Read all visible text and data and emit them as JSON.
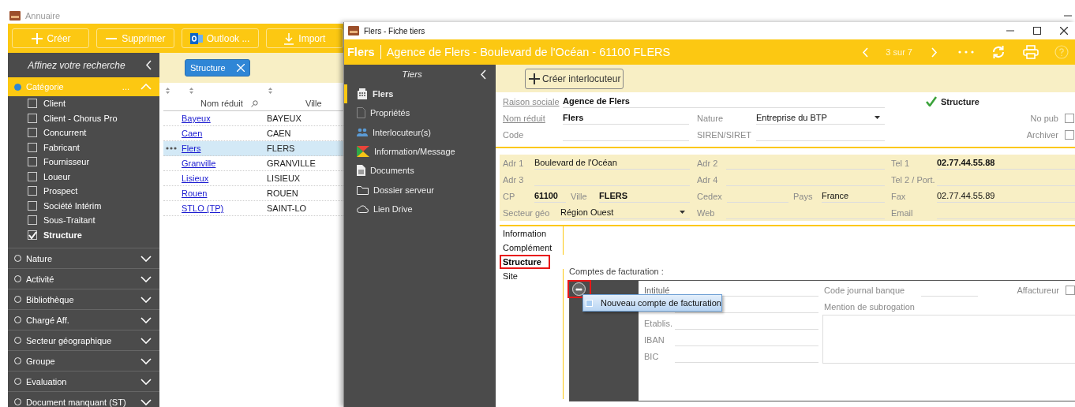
{
  "annuaire": {
    "title": "Annuaire",
    "toolbar": [
      {
        "label": "Créer"
      },
      {
        "label": "Supprimer"
      },
      {
        "label": "Outlook ..."
      },
      {
        "label": "Import"
      }
    ],
    "filters": {
      "title": "Affinez votre recherche",
      "groups": [
        {
          "label": "Catégorie",
          "expanded": true,
          "active": true,
          "more": "...",
          "items": [
            {
              "label": "Client",
              "checked": false
            },
            {
              "label": "Client - Chorus Pro",
              "checked": false
            },
            {
              "label": "Concurrent",
              "checked": false
            },
            {
              "label": "Fabricant",
              "checked": false
            },
            {
              "label": "Fournisseur",
              "checked": false
            },
            {
              "label": "Loueur",
              "checked": false
            },
            {
              "label": "Prospect",
              "checked": false
            },
            {
              "label": "Société Intérim",
              "checked": false
            },
            {
              "label": "Sous-Traitant",
              "checked": false
            },
            {
              "label": "Structure",
              "checked": true
            }
          ]
        },
        {
          "label": "Nature",
          "expanded": false,
          "active": false
        },
        {
          "label": "Activité",
          "expanded": false,
          "active": false
        },
        {
          "label": "Bibliothèque",
          "expanded": false,
          "active": false
        },
        {
          "label": "Chargé Aff.",
          "expanded": false,
          "active": false
        },
        {
          "label": "Secteur géographique",
          "expanded": false,
          "active": false
        },
        {
          "label": "Groupe",
          "expanded": false,
          "active": false
        },
        {
          "label": "Evaluation",
          "expanded": false,
          "active": false
        },
        {
          "label": "Document manquant (ST)",
          "expanded": false,
          "active": false
        }
      ]
    },
    "chips": [
      {
        "label": "Structure"
      }
    ],
    "table": {
      "columns": [
        {
          "label": "Nom réduit"
        },
        {
          "label": "Ville"
        }
      ],
      "rows": [
        {
          "name": "Bayeux",
          "city": "BAYEUX",
          "selected": false
        },
        {
          "name": "Caen",
          "city": "CAEN",
          "selected": false
        },
        {
          "name": "Flers",
          "city": "FLERS",
          "selected": true
        },
        {
          "name": "Granville",
          "city": "GRANVILLE",
          "selected": false
        },
        {
          "name": "Lisieux",
          "city": "LISIEUX",
          "selected": false
        },
        {
          "name": "Rouen",
          "city": "ROUEN",
          "selected": false
        },
        {
          "name": "STLO (TP)",
          "city": "SAINT-LO",
          "selected": false
        }
      ]
    }
  },
  "fiche": {
    "title": "Flers - Fiche tiers",
    "header": {
      "name": "Flers",
      "description": "Agence de Flers - Boulevard de l'Océan - 61100 FLERS",
      "pager": "3 sur 7"
    },
    "nav": {
      "title": "Tiers",
      "items": [
        {
          "label": "Flers",
          "selected": true
        },
        {
          "label": "Propriétés",
          "selected": false
        },
        {
          "label": "Interlocuteur(s)",
          "selected": false
        },
        {
          "label": "Information/Message",
          "selected": false
        },
        {
          "label": "Documents",
          "selected": false
        },
        {
          "label": "Dossier serveur",
          "selected": false
        },
        {
          "label": "Lien Drive",
          "selected": false
        }
      ]
    },
    "create_button": "Créer interlocuteur",
    "identity": {
      "rows": [
        {
          "fields": [
            {
              "label": "Raison sociale",
              "value": "Agence de Flers",
              "kind": "text",
              "link": true,
              "bold": true
            }
          ]
        },
        {
          "fields": [
            {
              "label": "Nom réduit",
              "value": "Flers",
              "kind": "text",
              "link": true,
              "bold": true
            },
            {
              "label": "Nature",
              "value": "Entreprise du BTP",
              "kind": "select",
              "link": false,
              "bold": false
            }
          ]
        },
        {
          "fields": [
            {
              "label": "Code",
              "kind": "text",
              "link": false
            },
            {
              "label": "SIREN/SIRET",
              "kind": "text",
              "link": false
            }
          ]
        }
      ],
      "structure": {
        "label": "Structure",
        "checked": true
      },
      "options": [
        {
          "label": "No pub",
          "checked": false
        },
        {
          "label": "Archiver",
          "checked": false
        }
      ]
    },
    "address": {
      "rows": [
        {
          "fields": [
            {
              "label": "Adr 1",
              "value": "Boulevard de l'Océan",
              "kind": "text",
              "bold": false
            },
            {
              "label": "Adr 2",
              "kind": "text"
            },
            {
              "label": "Tel 1",
              "value": "02.77.44.55.88",
              "kind": "text",
              "bold": true
            }
          ]
        },
        {
          "fields": [
            {
              "label": "Adr 3",
              "kind": "text"
            },
            {
              "label": "Adr 4",
              "kind": "text"
            },
            {
              "label": "Tel 2 / Port.",
              "kind": "text"
            }
          ]
        },
        {
          "fields": [
            {
              "label": "CP",
              "value": "61100",
              "kind": "text",
              "bold": true
            },
            {
              "label": "Ville",
              "value": "FLERS",
              "kind": "text",
              "bold": true
            },
            {
              "label": "Cedex",
              "kind": "text"
            },
            {
              "label": "Pays",
              "value": "France",
              "kind": "text",
              "bold": false
            },
            {
              "label": "Fax",
              "value": "02.77.44.55.89",
              "kind": "text",
              "bold": false
            }
          ]
        },
        {
          "fields": [
            {
              "label": "Secteur géo",
              "value": "Région Ouest",
              "kind": "select",
              "bold": false
            },
            {
              "label": "Web",
              "kind": "text"
            },
            {
              "label": "Email",
              "kind": "text"
            }
          ]
        }
      ]
    },
    "tabs": [
      {
        "label": "Information",
        "selected": false,
        "highlighted": false
      },
      {
        "label": "Complément",
        "selected": false,
        "highlighted": false
      },
      {
        "label": "Structure",
        "selected": true,
        "highlighted": true
      },
      {
        "label": "Site",
        "selected": false,
        "highlighted": false
      }
    ],
    "billing": {
      "title": "Comptes de facturation :",
      "highlighted": true,
      "tooltip": "Nouveau compte de facturation",
      "fields": [
        {
          "label": "Intitulé"
        },
        {
          "label": "Etablis."
        },
        {
          "label": "IBAN"
        },
        {
          "label": "BIC"
        }
      ],
      "journal": {
        "label": "Code journal banque"
      },
      "factor": {
        "label": "Affactureur",
        "checked": false
      },
      "subrogation": {
        "label": "Mention de subrogation"
      }
    }
  }
}
